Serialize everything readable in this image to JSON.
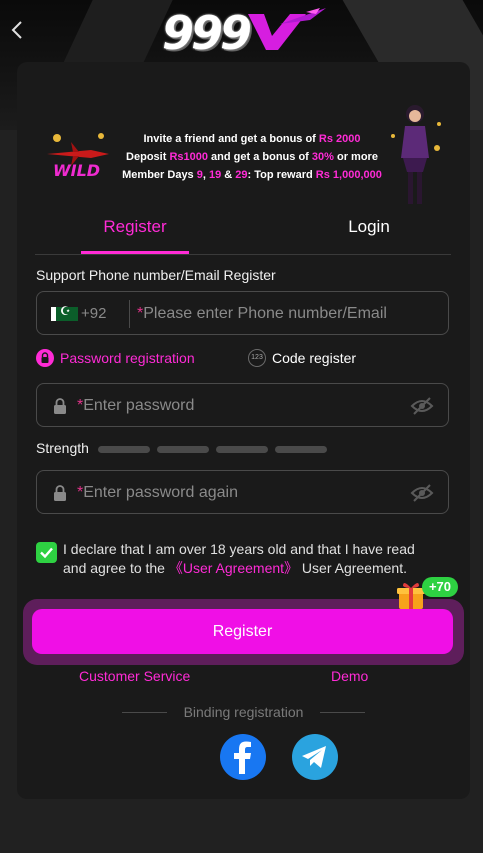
{
  "header": {
    "logo_text": "999",
    "back_icon": "chevron-left-icon"
  },
  "banner": {
    "line1_a": "Invite a friend and get a bonus of ",
    "line1_b": "Rs 2000",
    "line2_a": "Deposit ",
    "line2_b": "Rs1000",
    "line2_c": " and get a bonus of ",
    "line2_d": "30%",
    "line2_e": " or more",
    "line3_a": "Member Days ",
    "line3_b": "9",
    "line3_c": ", ",
    "line3_d": "19",
    "line3_e": " & ",
    "line3_f": "29",
    "line3_g": ": Top reward ",
    "line3_h": "Rs 1,000,000",
    "wild_label": "WILD"
  },
  "tabs": {
    "register": "Register",
    "login": "Login",
    "active": "register"
  },
  "form": {
    "subtitle": "Support Phone number/Email Register",
    "country_code": "+92",
    "phone_placeholder": "Please enter Phone number/Email",
    "required_mark": "*",
    "mode_password": "Password registration",
    "mode_code": "Code register",
    "mode_code_icon_text": "123",
    "password_placeholder": "Enter password",
    "strength_label": "Strength",
    "strength_level": 0,
    "confirm_placeholder": "Enter password again",
    "agree_checked": true,
    "agree_text_a": "I declare that I am over 18 years old and that I have read and agree to the ",
    "agree_link": "《User Agreement》",
    "agree_text_b": " User Agreement."
  },
  "actions": {
    "register_button": "Register",
    "bonus_badge": "+70",
    "customer_service": "Customer Service",
    "demo": "Demo",
    "binding_label": "Binding registration"
  },
  "colors": {
    "accent": "#ff2bd6",
    "button": "#f00fe6",
    "check": "#2ed142",
    "facebook": "#1877f2",
    "telegram": "#2aa3df"
  }
}
